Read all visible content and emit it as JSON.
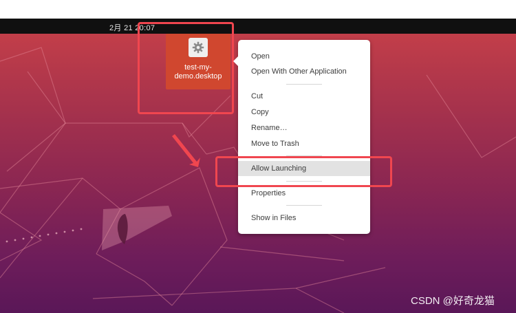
{
  "topbar": {
    "clock": "2月 21 20:07"
  },
  "desktop_icon": {
    "label": "test-my-demo.desktop",
    "icon": "gear-icon"
  },
  "context_menu": {
    "items": [
      {
        "label": "Open"
      },
      {
        "label": "Open With Other Application"
      },
      {
        "label": "Cut"
      },
      {
        "label": "Copy"
      },
      {
        "label": "Rename…"
      },
      {
        "label": "Move to Trash"
      },
      {
        "label": "Allow Launching",
        "highlighted": true
      },
      {
        "label": "Properties"
      },
      {
        "label": "Show in Files"
      }
    ]
  },
  "annotations": {
    "box_color": "#f0464f",
    "arrow_color": "#f0464f"
  },
  "watermark": "CSDN @好奇龙猫",
  "colors": {
    "wallpaper_top": "#c23e49",
    "wallpaper_bottom": "#5a1758",
    "icon_tile": "#d0472f"
  }
}
